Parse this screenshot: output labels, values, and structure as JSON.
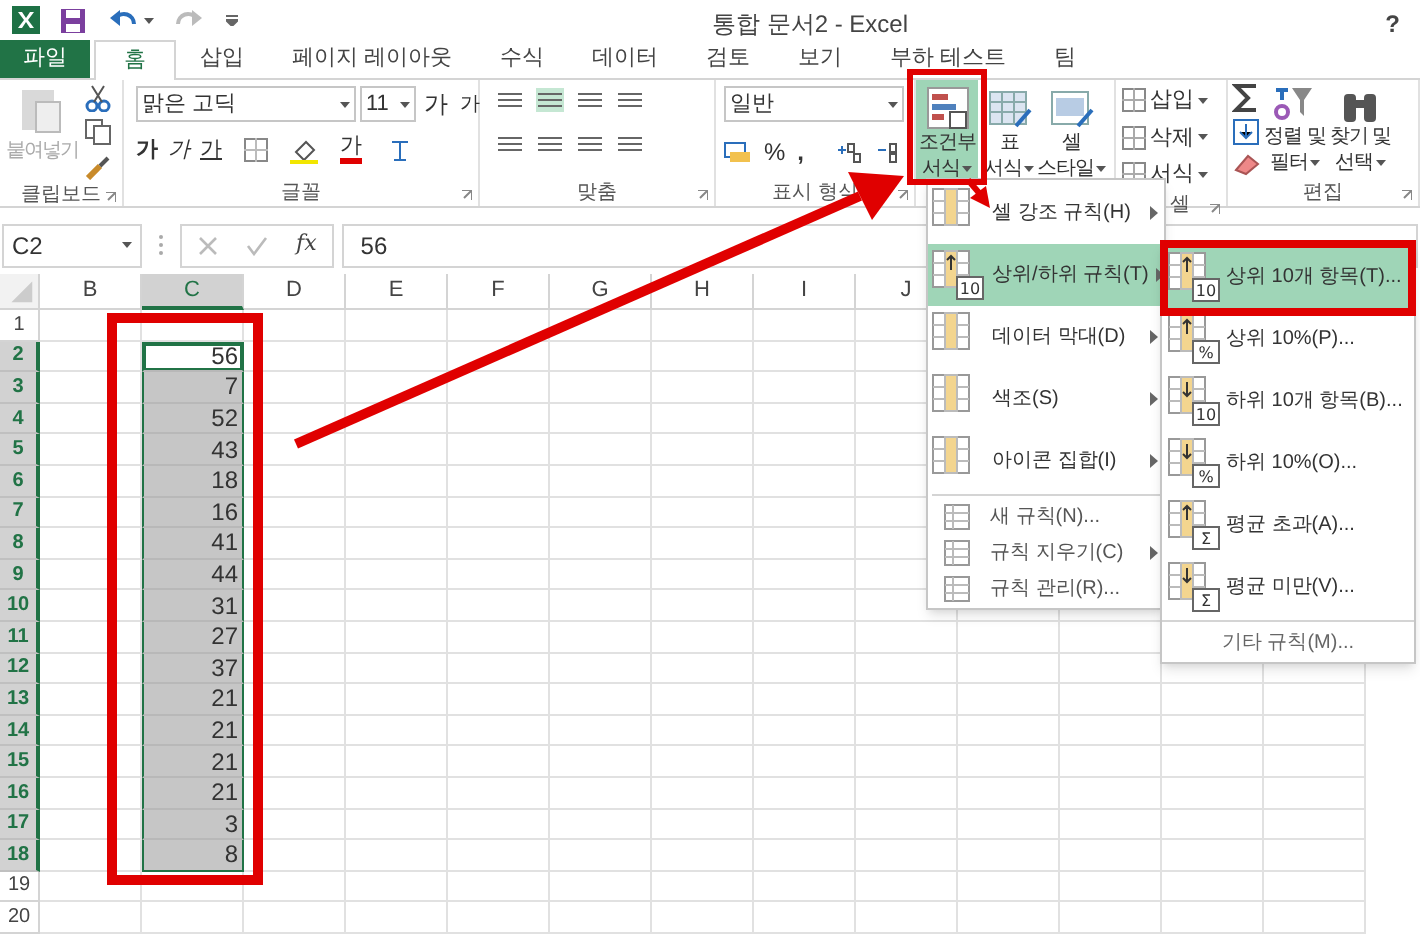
{
  "window": {
    "title": "통합 문서2 - Excel",
    "help": "?"
  },
  "tabs": [
    {
      "label": "파일",
      "kind": "file",
      "selected": false
    },
    {
      "label": "홈",
      "kind": "tab",
      "selected": true
    },
    {
      "label": "삽입",
      "kind": "tab",
      "selected": false
    },
    {
      "label": "페이지 레이아웃",
      "kind": "tab",
      "selected": false
    },
    {
      "label": "수식",
      "kind": "tab",
      "selected": false
    },
    {
      "label": "데이터",
      "kind": "tab",
      "selected": false
    },
    {
      "label": "검토",
      "kind": "tab",
      "selected": false
    },
    {
      "label": "보기",
      "kind": "tab",
      "selected": false
    },
    {
      "label": "부하 테스트",
      "kind": "tab",
      "selected": false
    },
    {
      "label": "팀",
      "kind": "tab",
      "selected": false
    }
  ],
  "ribbon": {
    "clipboard": {
      "label": "클립보드",
      "paste": {
        "label": "붙여넣기",
        "disabled": true
      }
    },
    "font": {
      "label": "글꼴",
      "font_name": "맑은 고딕",
      "font_size": "11",
      "grow": "가",
      "shrink": "가",
      "styles": [
        {
          "label": "가",
          "kind": "bold"
        },
        {
          "label": "가",
          "kind": "italic"
        },
        {
          "label": "가",
          "kind": "underline"
        }
      ],
      "font_color": "가"
    },
    "alignment": {
      "label": "맞춤"
    },
    "number": {
      "label": "표시 형식",
      "format": "일반",
      "percent": "%",
      "comma": ","
    },
    "styles": {
      "buttons": [
        {
          "lines": [
            "조건부",
            "서식"
          ],
          "selected": true
        },
        {
          "lines": [
            "표",
            "서식"
          ],
          "selected": false
        },
        {
          "lines": [
            "셀",
            "스타일"
          ],
          "selected": false
        }
      ]
    },
    "cells": {
      "label": "셀",
      "buttons": [
        "삽입",
        "삭제",
        "서식"
      ]
    },
    "editing": {
      "label": "편집",
      "buttons": [
        {
          "lines": [
            "정렬 및",
            "필터"
          ]
        },
        {
          "lines": [
            "찾기 및",
            "선택"
          ]
        }
      ]
    }
  },
  "formula_bar": {
    "name_box": "C2",
    "fx": "fx",
    "value": "56"
  },
  "sheet": {
    "columns": [
      {
        "label": "B",
        "selected": false
      },
      {
        "label": "C",
        "selected": true
      },
      {
        "label": "D",
        "selected": false
      },
      {
        "label": "E",
        "selected": false
      },
      {
        "label": "F",
        "selected": false
      },
      {
        "label": "G",
        "selected": false
      },
      {
        "label": "H",
        "selected": false
      },
      {
        "label": "I",
        "selected": false
      },
      {
        "label": "J",
        "selected": false
      }
    ],
    "rows": [
      {
        "number": "1",
        "selected": false,
        "active": false
      },
      {
        "number": "2",
        "selected": true,
        "active": true,
        "value": "56"
      },
      {
        "number": "3",
        "selected": true,
        "active": false,
        "value": "7"
      },
      {
        "number": "4",
        "selected": true,
        "active": false,
        "value": "52"
      },
      {
        "number": "5",
        "selected": true,
        "active": false,
        "value": "43"
      },
      {
        "number": "6",
        "selected": true,
        "active": false,
        "value": "18"
      },
      {
        "number": "7",
        "selected": true,
        "active": false,
        "value": "16"
      },
      {
        "number": "8",
        "selected": true,
        "active": false,
        "value": "41"
      },
      {
        "number": "9",
        "selected": true,
        "active": false,
        "value": "44"
      },
      {
        "number": "10",
        "selected": true,
        "active": false,
        "value": "31"
      },
      {
        "number": "11",
        "selected": true,
        "active": false,
        "value": "27"
      },
      {
        "number": "12",
        "selected": true,
        "active": false,
        "value": "37"
      },
      {
        "number": "13",
        "selected": true,
        "active": false,
        "value": "21"
      },
      {
        "number": "14",
        "selected": true,
        "active": false,
        "value": "21"
      },
      {
        "number": "15",
        "selected": true,
        "active": false,
        "value": "21"
      },
      {
        "number": "16",
        "selected": true,
        "active": false,
        "value": "21"
      },
      {
        "number": "17",
        "selected": true,
        "active": false,
        "value": "3"
      },
      {
        "number": "18",
        "selected": true,
        "active": false,
        "value": "8"
      },
      {
        "number": "19",
        "selected": false,
        "active": false
      },
      {
        "number": "20",
        "selected": false,
        "active": false
      }
    ]
  },
  "menu": {
    "items": [
      {
        "kind": "large",
        "label": "셀 강조 규칙(H)",
        "submenu": true,
        "selected": false
      },
      {
        "kind": "large",
        "label": "상위/하위 규칙(T)",
        "submenu": true,
        "selected": true,
        "badge": "10"
      },
      {
        "kind": "large",
        "label": "데이터 막대(D)",
        "submenu": true,
        "selected": false
      },
      {
        "kind": "large",
        "label": "색조(S)",
        "submenu": true,
        "selected": false
      },
      {
        "kind": "large",
        "label": "아이콘 집합(I)",
        "submenu": true,
        "selected": false
      },
      {
        "kind": "small",
        "label": "새 규칙(N)...",
        "submenu": false,
        "selected": false
      },
      {
        "kind": "small",
        "label": "규칙 지우기(C)",
        "submenu": true,
        "selected": false
      },
      {
        "kind": "small",
        "label": "규칙 관리(R)...",
        "submenu": false,
        "selected": false
      }
    ]
  },
  "submenu": {
    "items": [
      {
        "label": "상위 10개 항목(T)...",
        "selected": true,
        "badge": "10"
      },
      {
        "label": "상위 10%(P)...",
        "selected": false,
        "badge": "%"
      },
      {
        "label": "하위 10개 항목(B)...",
        "selected": false,
        "badge": "10"
      },
      {
        "label": "하위 10%(O)...",
        "selected": false,
        "badge": "%"
      },
      {
        "label": "평균 초과(A)...",
        "selected": false,
        "badge": "Σ"
      },
      {
        "label": "평균 미만(V)...",
        "selected": false,
        "badge": "Σ"
      }
    ],
    "more": "기타 규칙(M)..."
  }
}
